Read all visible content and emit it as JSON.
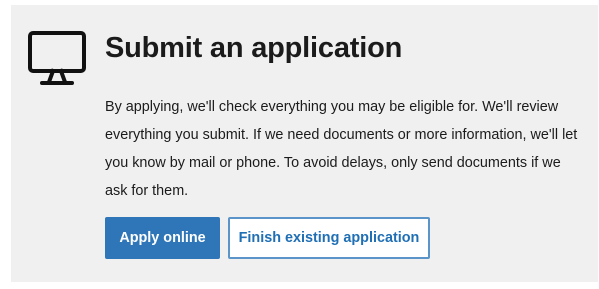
{
  "panel": {
    "icon": "computer-monitor-icon",
    "title": "Submit an application",
    "description": "By applying, we'll check everything you may be eligible for. We'll review everything you submit. If we need documents or more information, we'll let you know by mail or phone. To avoid delays, only send documents if we ask for them."
  },
  "actions": {
    "apply_label": "Apply online",
    "finish_label": "Finish existing application"
  },
  "colors": {
    "panel_background": "#f0f0f0",
    "primary_button": "#2e76b8",
    "secondary_text": "#1f6fb5",
    "secondary_border": "#5b94c8"
  }
}
